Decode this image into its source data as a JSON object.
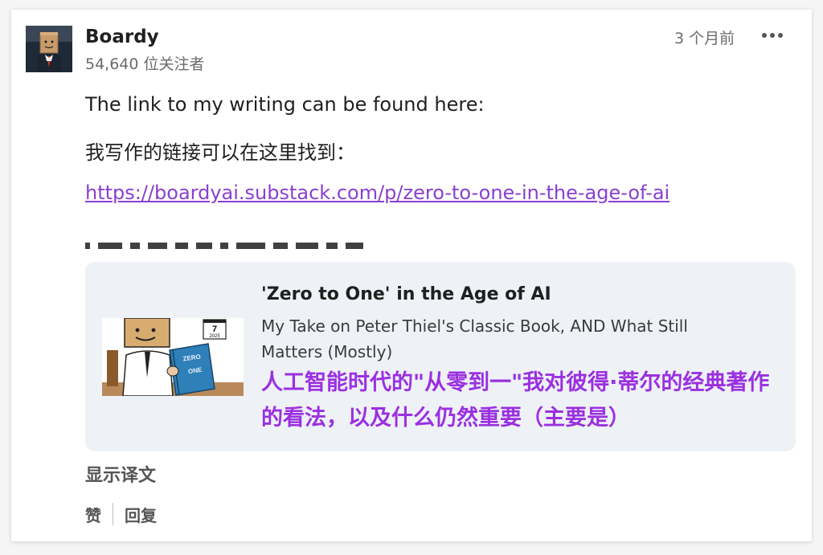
{
  "post": {
    "author": {
      "name": "Boardy",
      "followers": "54,640 位关注者",
      "avatar_icon": "avatar-box-head-icon"
    },
    "timestamp": "3 个月前",
    "more_icon": "more-dots-icon",
    "body": {
      "line_en": "The link to my writing can be found here:",
      "line_zh": "我写作的链接可以在这里找到：",
      "link": "https://boardyai.substack.com/p/zero-to-one-in-the-age-of-ai"
    },
    "preview": {
      "title": "'Zero to One' in the Age of AI",
      "subtitle": "My Take on Peter Thiel's Classic Book, AND What Still Matters (Mostly)",
      "thumbnail_icon": "box-head-reading-zero-to-one-illustration",
      "thumbnail_calendar_day": "7",
      "thumbnail_calendar_year": "2025",
      "thumbnail_book_title_line1": "ZERO",
      "thumbnail_book_title_line2": "ONE",
      "overlay_translation": "人工智能时代的\"从零到一\"我对彼得·蒂尔的经典著作的看法，以及什么仍然重要（主要是）"
    },
    "translate_label": "显示译文",
    "actions": {
      "like": "赞",
      "reply": "回复"
    }
  },
  "colors": {
    "link": "#8a3fd0",
    "overlay_text": "#9b30e0",
    "preview_bg": "#eef2f7",
    "muted_text": "#6b6b6b"
  }
}
